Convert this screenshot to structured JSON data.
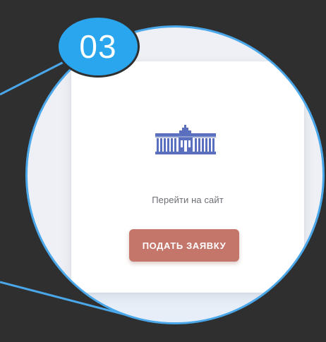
{
  "badge": {
    "number": "03"
  },
  "card": {
    "link_text": "Перейти на сайт",
    "apply_button": "ПОДАТЬ ЗАЯВКУ"
  },
  "colors": {
    "background": "#2f2f2f",
    "accent_blue": "#29a6ee",
    "circle_border": "#4aa8ea",
    "button": "#c4766b",
    "logo": "#5b6fbf"
  },
  "icons": [
    "government-building-logo-icon"
  ]
}
